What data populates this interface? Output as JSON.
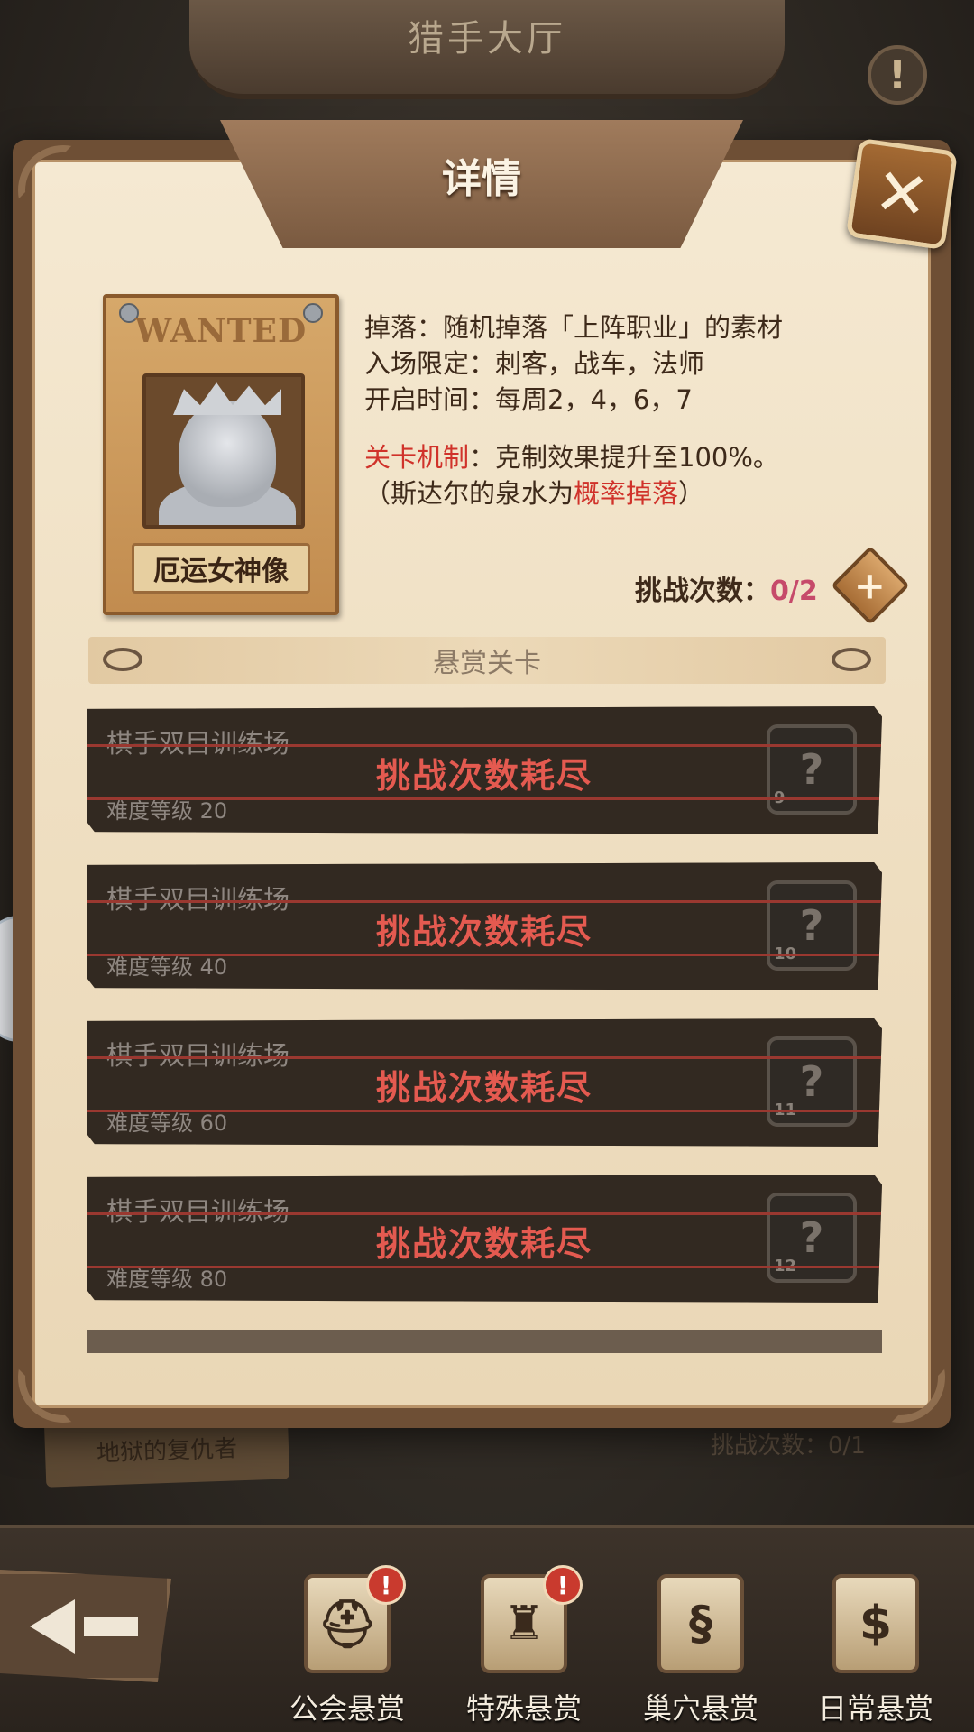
{
  "background": {
    "hall_title": "猎手大厅",
    "alert_icon": "!",
    "behind_label": "地狱的复仇者",
    "behind_count": "挑战次数：0/1"
  },
  "modal": {
    "title": "详情",
    "close_icon": "✕",
    "wanted": {
      "header": "WANTED",
      "boss_name": "厄运女神像"
    },
    "info": {
      "drop": "掉落：随机掉落「上阵职业」的素材",
      "entry_limit": "入场限定：刺客，战车，法师",
      "open_time": "开启时间：每周2，4，6，7",
      "mechanic_label": "关卡机制",
      "mechanic_text": "：克制效果提升至100%。",
      "note_prefix": "（斯达尔的泉水为",
      "note_highlight": "概率掉落",
      "note_suffix": "）"
    },
    "challenge": {
      "label": "挑战次数：",
      "value": "0/2",
      "add_icon": "+"
    },
    "section_title": "悬赏关卡",
    "stages": [
      {
        "name": "棋手双目训练场",
        "level": "难度等级 20",
        "status": "挑战次数耗尽",
        "reward_count": "9"
      },
      {
        "name": "棋手双目训练场",
        "level": "难度等级 40",
        "status": "挑战次数耗尽",
        "reward_count": "10"
      },
      {
        "name": "棋手双目训练场",
        "level": "难度等级 60",
        "status": "挑战次数耗尽",
        "reward_count": "11"
      },
      {
        "name": "棋手双目训练场",
        "level": "难度等级 80",
        "status": "挑战次数耗尽",
        "reward_count": "12"
      }
    ]
  },
  "nav": {
    "back_icon": "back-arrow-icon",
    "items": [
      {
        "label": "公会悬赏",
        "icon": "helmet-icon",
        "badge": "!"
      },
      {
        "label": "特殊悬赏",
        "icon": "spartan-helmet-icon",
        "badge": "!"
      },
      {
        "label": "巢穴悬赏",
        "icon": "dragon-icon"
      },
      {
        "label": "日常悬赏",
        "icon": "dollar-icon"
      }
    ]
  }
}
